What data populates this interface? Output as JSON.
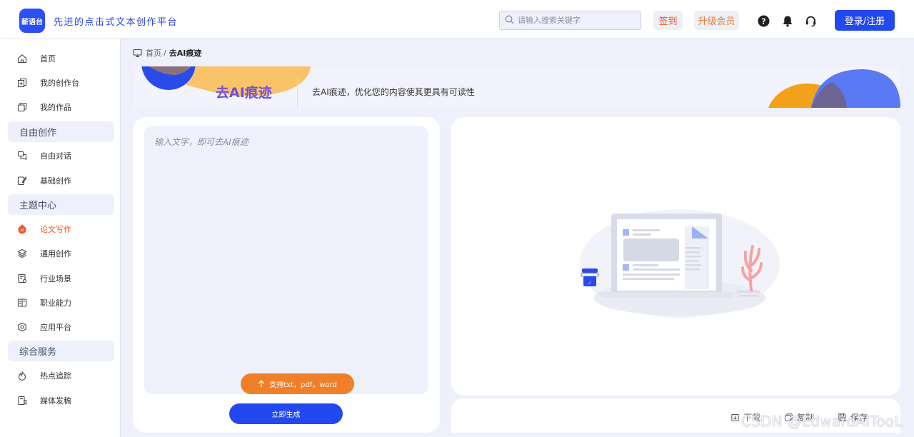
{
  "header": {
    "logo_text": "薪语台",
    "slogan": "先进的点击式文本创作平台",
    "search_placeholder": "请输入搜索关键字",
    "signin_label": "签到",
    "upgrade_label": "升级会员",
    "login_label": "登录/注册",
    "colors": {
      "brand": "#2248f0",
      "signin": "#f0562b",
      "upgrade": "#f07b36"
    }
  },
  "sidebar": {
    "items": [
      {
        "label": "首页",
        "icon": "home-icon"
      },
      {
        "label": "我的创作台",
        "icon": "workspace-icon"
      },
      {
        "label": "我的作品",
        "icon": "works-icon"
      }
    ],
    "free_creation": {
      "title": "自由创作",
      "items": [
        {
          "label": "自由对话",
          "icon": "chat-icon"
        },
        {
          "label": "基础创作",
          "icon": "edit-icon"
        }
      ]
    },
    "topic_center": {
      "title": "主题中心",
      "items": [
        {
          "label": "论文写作",
          "icon": "paper-icon",
          "active": true
        },
        {
          "label": "通用创作",
          "icon": "layers-icon"
        },
        {
          "label": "行业场景",
          "icon": "scene-icon"
        },
        {
          "label": "职业能力",
          "icon": "career-icon"
        },
        {
          "label": "应用平台",
          "icon": "platform-icon"
        }
      ]
    },
    "services": {
      "title": "综合服务",
      "items": [
        {
          "label": "热点追踪",
          "icon": "hot-icon"
        },
        {
          "label": "媒体发稿",
          "icon": "media-icon"
        }
      ]
    }
  },
  "breadcrumb": {
    "home": "首页",
    "separator": "/",
    "current": "去AI痕迹"
  },
  "banner": {
    "title": "去AI痕迹",
    "description": "去AI痕迹，优化您的内容使其更具有可读性"
  },
  "editor": {
    "placeholder": "输入文字，即可去AI痕迹",
    "upload_label": "支持txt，pdf，word",
    "generate_label": "立即生成"
  },
  "output": {
    "actions": [
      {
        "label": "下载",
        "icon": "download-icon"
      },
      {
        "label": "复制",
        "icon": "copy-icon"
      },
      {
        "label": "保存",
        "icon": "save-icon"
      }
    ]
  },
  "watermark": "CSDN @EdwardAITooL"
}
